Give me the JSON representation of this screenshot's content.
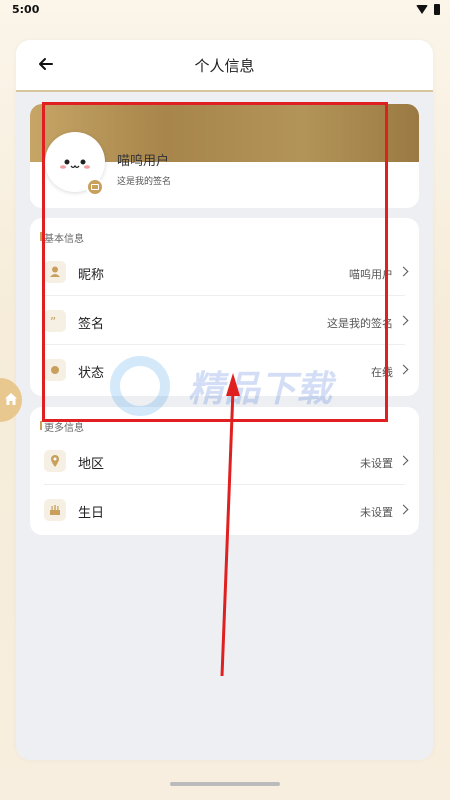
{
  "status_bar": {
    "time": "5:00"
  },
  "header": {
    "title": "个人信息"
  },
  "profile": {
    "nickname": "喵呜用户",
    "signature": "这是我的签名"
  },
  "basic_section": {
    "title": "基本信息",
    "rows": [
      {
        "label": "昵称",
        "value": "喵呜用户",
        "icon": "person-icon"
      },
      {
        "label": "签名",
        "value": "这是我的签名",
        "icon": "quote-icon"
      },
      {
        "label": "状态",
        "value": "在线",
        "icon": "dot-icon"
      }
    ]
  },
  "more_section": {
    "title": "更多信息",
    "rows": [
      {
        "label": "地区",
        "value": "未设置",
        "icon": "location-icon"
      },
      {
        "label": "生日",
        "value": "未设置",
        "icon": "cake-icon"
      }
    ]
  },
  "watermark": {
    "text": "精品下载"
  },
  "colors": {
    "accent": "#c8a05c",
    "annotation": "#e02020",
    "panel": "#eeeff3"
  }
}
